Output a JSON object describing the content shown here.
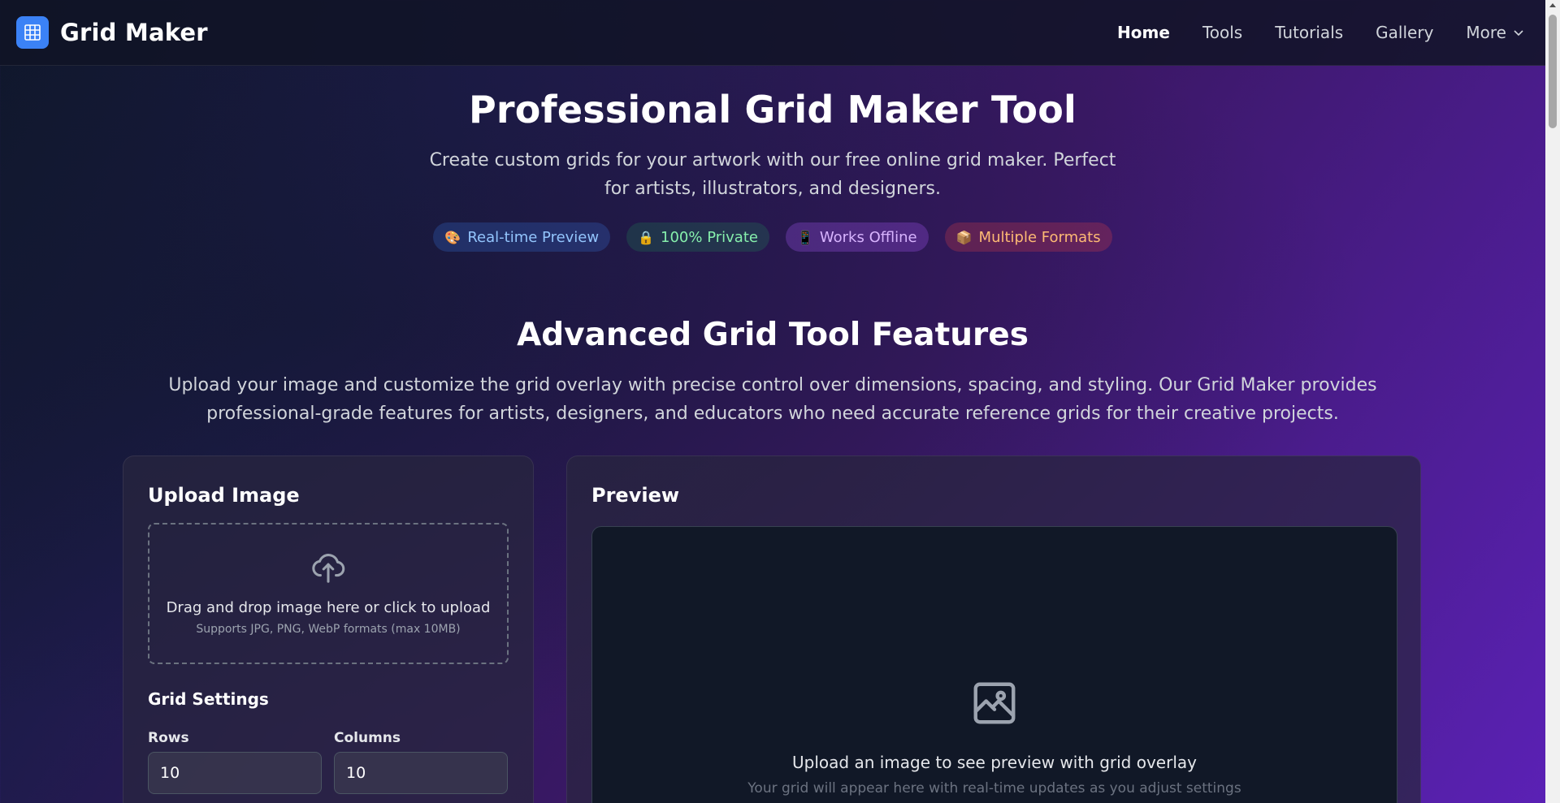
{
  "nav": {
    "brand": "Grid Maker",
    "logo_icon": "grid-icon",
    "links": [
      {
        "label": "Home",
        "active": true
      },
      {
        "label": "Tools"
      },
      {
        "label": "Tutorials"
      },
      {
        "label": "Gallery"
      },
      {
        "label": "More",
        "icon": "chevron-down-icon"
      }
    ]
  },
  "hero": {
    "title": "Professional Grid Maker Tool",
    "subtitle": "Create custom grids for your artwork with our free online grid maker. Perfect for artists, illustrators, and designers.",
    "badges": [
      {
        "icon": "🎨",
        "label": "Real-time Preview"
      },
      {
        "icon": "🔒",
        "label": "100% Private"
      },
      {
        "icon": "📱",
        "label": "Works Offline"
      },
      {
        "icon": "📦",
        "label": "Multiple Formats"
      }
    ]
  },
  "features": {
    "title": "Advanced Grid Tool Features",
    "description": "Upload your image and customize the grid overlay with precise control over dimensions, spacing, and styling. Our Grid Maker provides professional-grade features for artists, designers, and educators who need accurate reference grids for their creative projects."
  },
  "upload": {
    "title": "Upload Image",
    "drop_text": "Drag and drop image here or click to upload",
    "drop_hint": "Supports JPG, PNG, WebP formats (max 10MB)"
  },
  "grid_settings": {
    "title": "Grid Settings",
    "rows_label": "Rows",
    "rows_value": "10",
    "columns_label": "Columns",
    "columns_value": "10"
  },
  "preview": {
    "title": "Preview",
    "empty_text": "Upload an image to see preview with grid overlay",
    "empty_hint": "Your grid will appear here with real-time updates as you adjust settings"
  },
  "colors": {
    "brand": "#3b82f6",
    "accent_purple": "#5b21b6"
  }
}
